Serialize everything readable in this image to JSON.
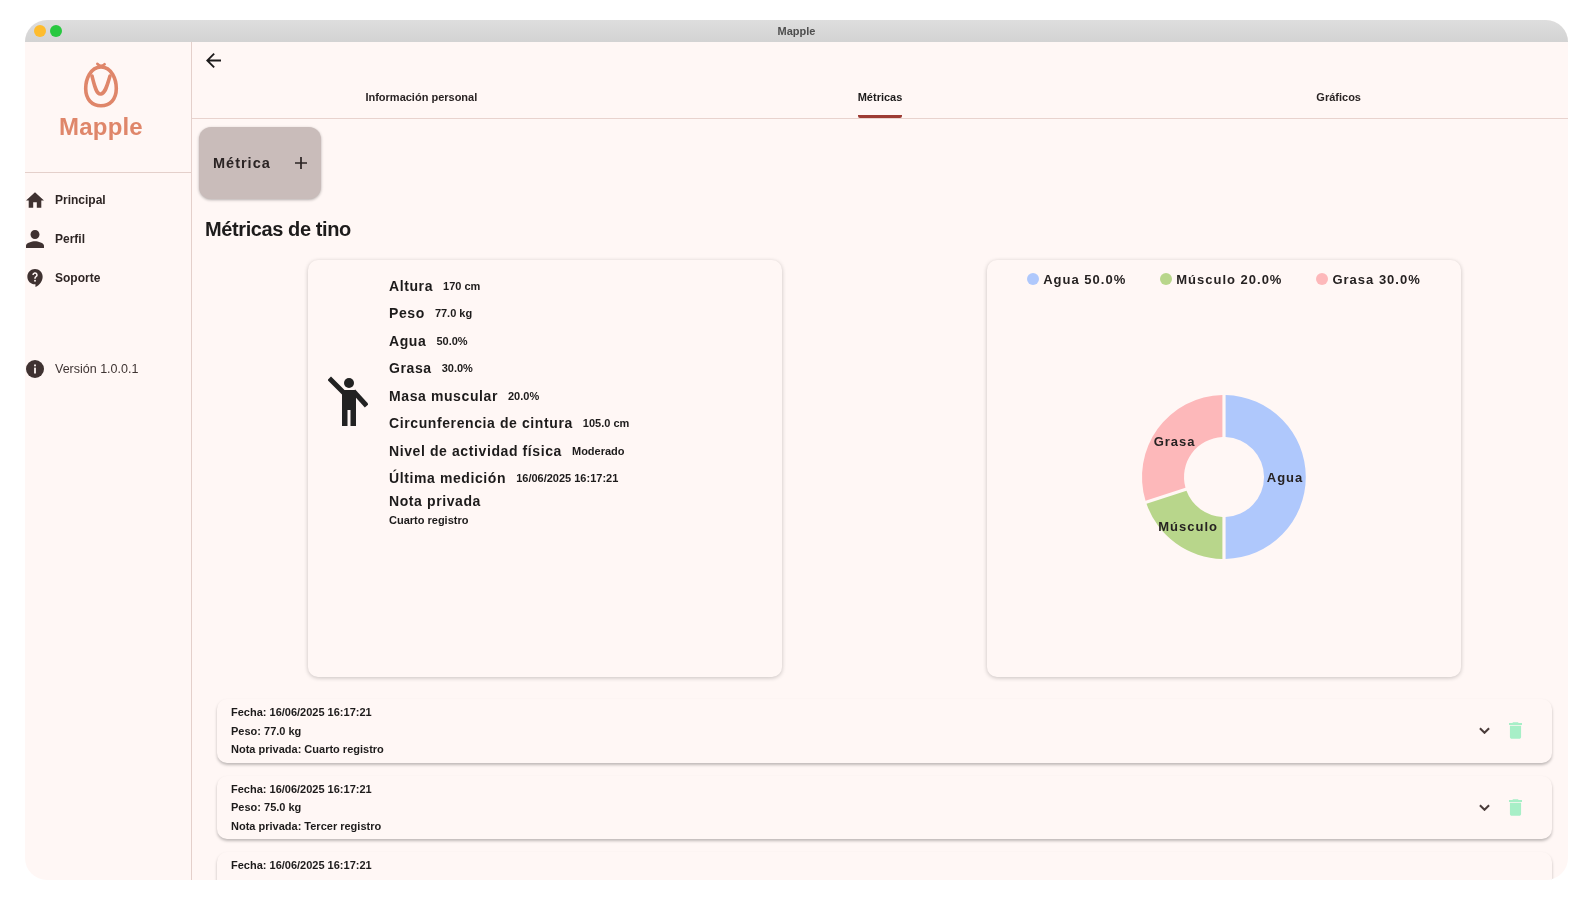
{
  "window": {
    "title": "Mapple"
  },
  "sidebar": {
    "brand": "Mapple",
    "items": [
      {
        "label": "Principal"
      },
      {
        "label": "Perfil"
      },
      {
        "label": "Soporte"
      }
    ],
    "version": "Versión 1.0.0.1"
  },
  "tabs": [
    {
      "label": "Información personal",
      "selected": false
    },
    {
      "label": "Métricas",
      "selected": true
    },
    {
      "label": "Gráficos",
      "selected": false
    }
  ],
  "add_button": {
    "label": "Métrica"
  },
  "heading": "Métricas de tino",
  "metrics": [
    {
      "kind": "inline",
      "label": "Altura",
      "value": "170 cm"
    },
    {
      "kind": "inline",
      "label": "Peso",
      "value": "77.0 kg"
    },
    {
      "kind": "inline",
      "label": "Agua",
      "value": "50.0%"
    },
    {
      "kind": "inline",
      "label": "Grasa",
      "value": "30.0%"
    },
    {
      "kind": "inline",
      "label": "Masa muscular",
      "value": "20.0%"
    },
    {
      "kind": "inline",
      "label": "Circunferencia de cintura",
      "value": "105.0 cm"
    },
    {
      "kind": "inline",
      "label": "Nivel de actividad física",
      "value": "Moderado"
    },
    {
      "kind": "inline",
      "label": "Última medición",
      "value": "16/06/2025 16:17:21"
    },
    {
      "kind": "stacked",
      "label": "Nota privada",
      "value": "Cuarto registro"
    }
  ],
  "chart": {
    "legend": [
      {
        "label": "Agua 50.0%",
        "color": "#afc8fc"
      },
      {
        "label": "Músculo 20.0%",
        "color": "#b8d68b"
      },
      {
        "label": "Grasa 30.0%",
        "color": "#fdb8ba"
      }
    ],
    "chart_data": {
      "type": "donut",
      "categories": [
        "Agua",
        "Músculo",
        "Grasa"
      ],
      "values": [
        50,
        20,
        30
      ]
    }
  },
  "records": [
    {
      "date": "Fecha: 16/06/2025 16:17:21",
      "weight": "Peso: 77.0 kg",
      "note": "Nota privada: Cuarto registro",
      "expanded": false
    },
    {
      "date": "Fecha: 16/06/2025 16:17:21",
      "weight": "Peso: 75.0 kg",
      "note": "Nota privada: Tercer registro",
      "expanded": false
    },
    {
      "date": "Fecha: 16/06/2025 16:17:21"
    }
  ]
}
